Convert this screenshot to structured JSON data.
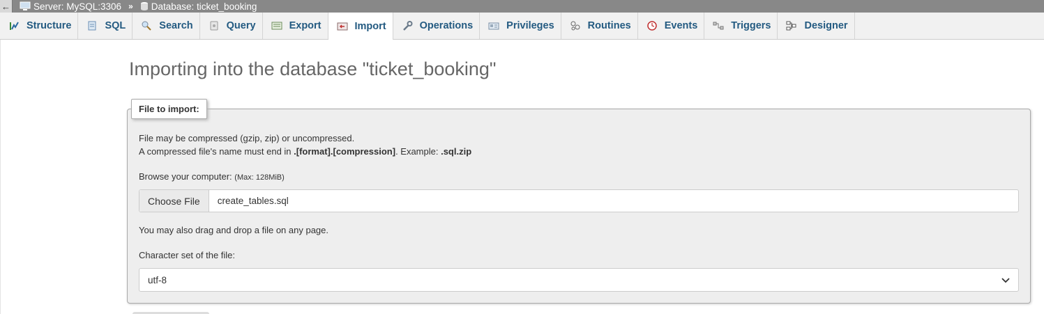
{
  "breadcrumb": {
    "back": "←",
    "server": "Server: MySQL:3306",
    "separator": "»",
    "database": "Database: ticket_booking"
  },
  "tabs": [
    {
      "label": "Structure",
      "icon": "structure-icon"
    },
    {
      "label": "SQL",
      "icon": "sql-icon"
    },
    {
      "label": "Search",
      "icon": "search-icon"
    },
    {
      "label": "Query",
      "icon": "query-icon"
    },
    {
      "label": "Export",
      "icon": "export-icon"
    },
    {
      "label": "Import",
      "icon": "import-icon",
      "active": true
    },
    {
      "label": "Operations",
      "icon": "wrench-icon"
    },
    {
      "label": "Privileges",
      "icon": "privileges-icon"
    },
    {
      "label": "Routines",
      "icon": "routines-icon"
    },
    {
      "label": "Events",
      "icon": "clock-icon"
    },
    {
      "label": "Triggers",
      "icon": "triggers-icon"
    },
    {
      "label": "Designer",
      "icon": "designer-icon"
    }
  ],
  "page": {
    "title": "Importing into the database \"ticket_booking\""
  },
  "import": {
    "legend": "File to import:",
    "compress_line1": "File may be compressed (gzip, zip) or uncompressed.",
    "compress_line2_pre": "A compressed file's name must end in ",
    "compress_line2_bold": ".[format].[compression]",
    "compress_line2_mid": ". Example: ",
    "compress_line2_example": ".sql.zip",
    "browse_label": "Browse your computer: ",
    "browse_max": "(Max: 128MiB)",
    "choose_button": "Choose File",
    "file_name": "create_tables.sql",
    "drag_text": "You may also drag and drop a file on any page.",
    "charset_label": "Character set of the file:",
    "charset_value": "utf-8"
  },
  "colors": {
    "tab_text": "#235a81",
    "breadcrumb_bg": "#888888",
    "fieldset_bg": "#eeeeee"
  }
}
